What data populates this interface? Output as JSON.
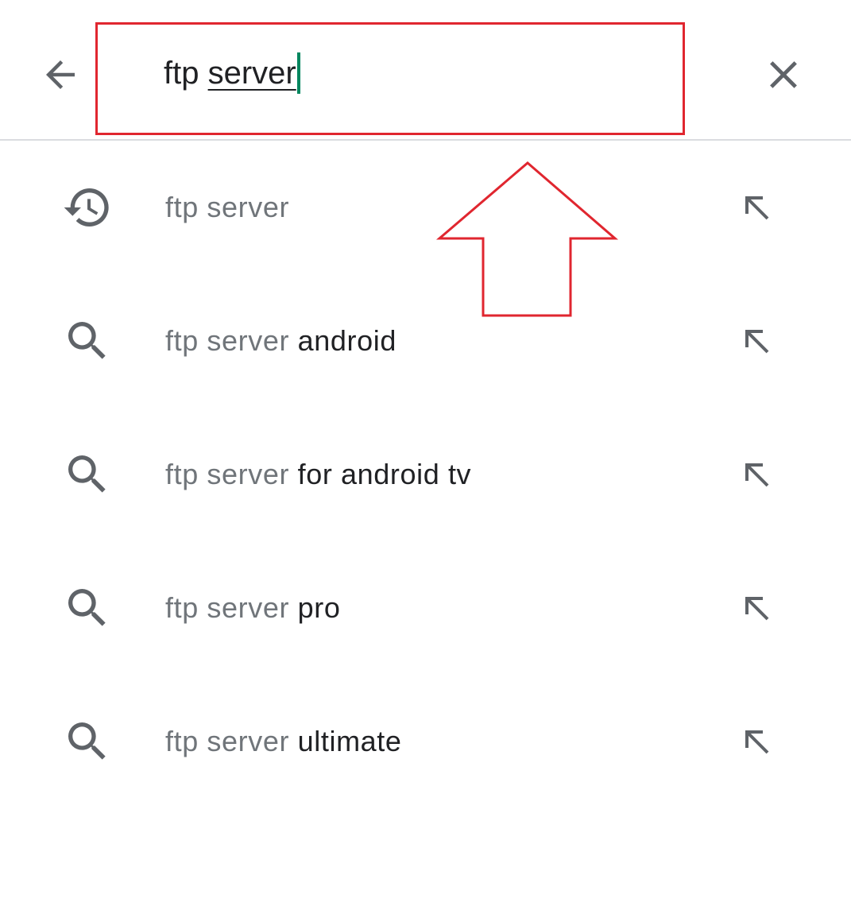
{
  "search": {
    "query_plain": "ftp ",
    "query_composing": "server"
  },
  "suggestions": [
    {
      "icon": "history-icon",
      "prefix": "ftp server",
      "suffix": ""
    },
    {
      "icon": "search-icon",
      "prefix": "ftp server",
      "suffix": " android"
    },
    {
      "icon": "search-icon",
      "prefix": "ftp server",
      "suffix": " for android tv"
    },
    {
      "icon": "search-icon",
      "prefix": "ftp server",
      "suffix": " pro"
    },
    {
      "icon": "search-icon",
      "prefix": "ftp server",
      "suffix": " ultimate"
    }
  ],
  "colors": {
    "icon_gray": "#5f6368",
    "prefix_gray": "#70757a",
    "text_dark": "#202124",
    "caret_green": "#01875f",
    "annotation_red": "#e0262f",
    "divider": "#dadce0"
  }
}
